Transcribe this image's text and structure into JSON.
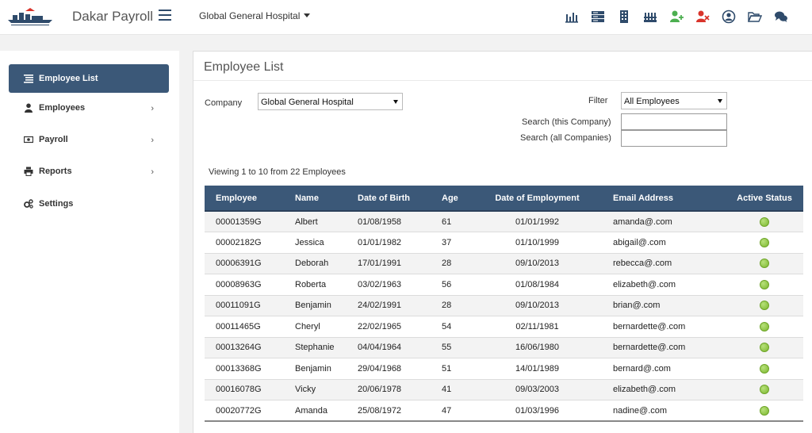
{
  "header": {
    "app_title": "Dakar Payroll",
    "company": "Global General Hospital",
    "icons": [
      "bar-chart-icon",
      "server-icon",
      "building-icon",
      "factory-icon",
      "user-add-icon",
      "user-remove-icon",
      "user-circle-icon",
      "folder-open-icon",
      "chat-icon"
    ],
    "accent_green": "#4caf50",
    "accent_red": "#d9342b"
  },
  "sidebar": {
    "items": [
      {
        "label": "Employee List",
        "icon": "list-icon",
        "active": true
      },
      {
        "label": "Employees",
        "icon": "user-icon",
        "has_children": true
      },
      {
        "label": "Payroll",
        "icon": "money-icon",
        "has_children": true
      },
      {
        "label": "Reports",
        "icon": "printer-icon",
        "has_children": true
      },
      {
        "label": "Settings",
        "icon": "cogs-icon"
      }
    ]
  },
  "main": {
    "title": "Employee List",
    "company_label": "Company",
    "company_value": "Global General Hospital",
    "filter_label": "Filter",
    "filter_value": "All Employees",
    "search_company_label": "Search (this Company)",
    "search_all_label": "Search (all Companies)",
    "search_company_value": "",
    "search_all_value": "",
    "viewing_text": "Viewing 1 to 10 from 22 Employees"
  },
  "table": {
    "columns": [
      "Employee",
      "Name",
      "Date of Birth",
      "Age",
      "Date of Employment",
      "Email Address",
      "Active Status"
    ],
    "rows": [
      {
        "employee": "00001359G",
        "name": "Albert",
        "dob": "01/08/1958",
        "age": "61",
        "doe": "01/01/1992",
        "email": "amanda@.com",
        "active": true
      },
      {
        "employee": "00002182G",
        "name": "Jessica",
        "dob": "01/01/1982",
        "age": "37",
        "doe": "01/10/1999",
        "email": "abigail@.com",
        "active": true
      },
      {
        "employee": "00006391G",
        "name": "Deborah",
        "dob": "17/01/1991",
        "age": "28",
        "doe": "09/10/2013",
        "email": "rebecca@.com",
        "active": true
      },
      {
        "employee": "00008963G",
        "name": "Roberta",
        "dob": "03/02/1963",
        "age": "56",
        "doe": "01/08/1984",
        "email": "elizabeth@.com",
        "active": true
      },
      {
        "employee": "00011091G",
        "name": "Benjamin",
        "dob": "24/02/1991",
        "age": "28",
        "doe": "09/10/2013",
        "email": "brian@.com",
        "active": true
      },
      {
        "employee": "00011465G",
        "name": "Cheryl",
        "dob": "22/02/1965",
        "age": "54",
        "doe": "02/11/1981",
        "email": "bernardette@.com",
        "active": true
      },
      {
        "employee": "00013264G",
        "name": "Stephanie",
        "dob": "04/04/1964",
        "age": "55",
        "doe": "16/06/1980",
        "email": "bernardette@.com",
        "active": true
      },
      {
        "employee": "00013368G",
        "name": "Benjamin",
        "dob": "29/04/1968",
        "age": "51",
        "doe": "14/01/1989",
        "email": "bernard@.com",
        "active": true
      },
      {
        "employee": "00016078G",
        "name": "Vicky",
        "dob": "20/06/1978",
        "age": "41",
        "doe": "09/03/2003",
        "email": "elizabeth@.com",
        "active": true
      },
      {
        "employee": "00020772G",
        "name": "Amanda",
        "dob": "25/08/1972",
        "age": "47",
        "doe": "01/03/1996",
        "email": "nadine@.com",
        "active": true
      }
    ]
  }
}
